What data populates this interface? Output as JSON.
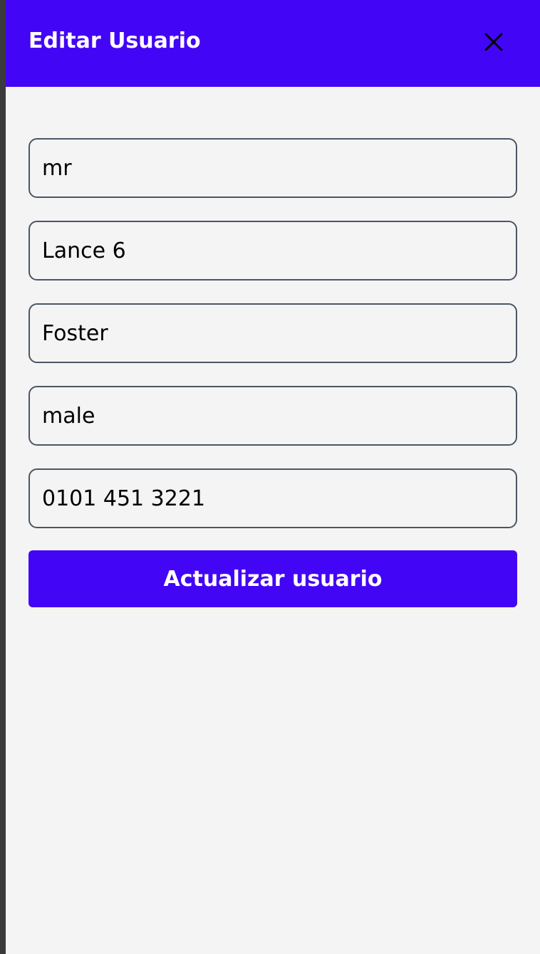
{
  "colors": {
    "accent": "#4305f5",
    "panel_background": "#f4f4f4",
    "field_border": "#4b5563",
    "left_strip": "#3a3a3a"
  },
  "header": {
    "title": "Editar Usuario",
    "close_icon": "close-icon"
  },
  "form": {
    "fields": [
      {
        "name": "title",
        "value": "mr"
      },
      {
        "name": "first-name",
        "value": "Lance 6"
      },
      {
        "name": "last-name",
        "value": "Foster"
      },
      {
        "name": "gender",
        "value": "male"
      },
      {
        "name": "phone",
        "value": "0101 451 3221"
      }
    ],
    "submit_label": "Actualizar usuario"
  }
}
